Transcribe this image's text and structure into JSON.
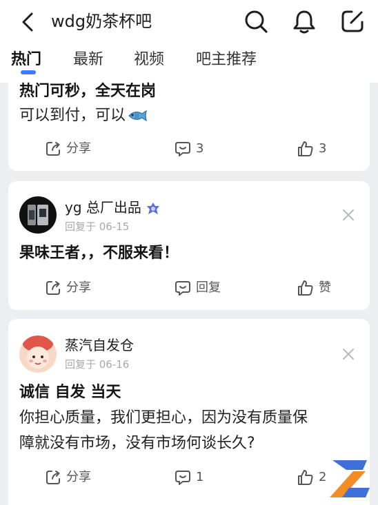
{
  "header": {
    "forum_name": "wdg奶茶杯吧",
    "icons": [
      "back-icon",
      "search-icon",
      "bell-icon",
      "edit-icon"
    ]
  },
  "tabs": [
    {
      "label": "热门",
      "active": true
    },
    {
      "label": "最新",
      "active": false
    },
    {
      "label": "视频",
      "active": false
    },
    {
      "label": "吧主推荐",
      "active": false
    }
  ],
  "posts": [
    {
      "title": "热门可秒，全天在岗",
      "body": [
        "可以到付，可以"
      ],
      "emoji": "fish-emoji",
      "actions": {
        "share": "分享",
        "comment": "3",
        "like": "3"
      }
    },
    {
      "username": "yg 总厂出品",
      "reply_time": "回复于 06-15",
      "title": "果味王者，，不服来看！",
      "actions": {
        "share": "分享",
        "comment": "回复",
        "like": "赞"
      }
    },
    {
      "username": "蒸汽自发仓",
      "reply_time": "回复于 06-16",
      "title": "诚信 自发 当天",
      "body": [
        "你担心质量，我们更担心，因为没有质量保",
        "障就没有市场，没有市场何谈长久?"
      ],
      "actions": {
        "share": "分享",
        "comment": "1",
        "like": "2"
      }
    }
  ],
  "colors": {
    "accent": "#3a7bff",
    "background": "#eceef1",
    "muted_text": "#a6a8ad"
  }
}
